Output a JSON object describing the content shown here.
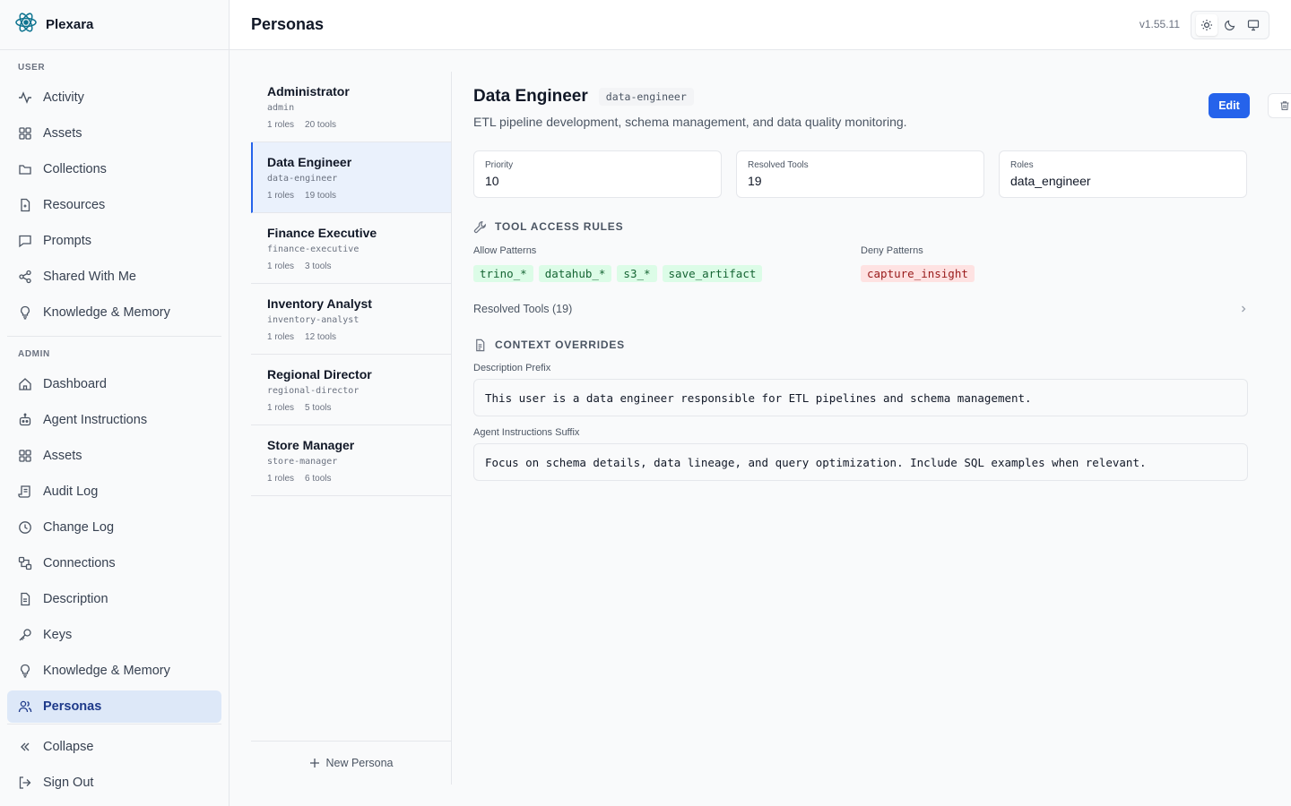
{
  "app": {
    "name": "Plexara",
    "version": "v1.55.11"
  },
  "header": {
    "title": "Personas"
  },
  "sidebar": {
    "user_label": "USER",
    "admin_label": "ADMIN",
    "user_items": [
      {
        "label": "Activity",
        "icon": "activity-icon"
      },
      {
        "label": "Assets",
        "icon": "grid-icon"
      },
      {
        "label": "Collections",
        "icon": "folder-icon"
      },
      {
        "label": "Resources",
        "icon": "file-icon"
      },
      {
        "label": "Prompts",
        "icon": "message-icon"
      },
      {
        "label": "Shared With Me",
        "icon": "share-icon"
      },
      {
        "label": "Knowledge & Memory",
        "icon": "lightbulb-icon"
      }
    ],
    "admin_items": [
      {
        "label": "Dashboard",
        "icon": "home-icon"
      },
      {
        "label": "Agent Instructions",
        "icon": "bot-icon"
      },
      {
        "label": "Assets",
        "icon": "grid-icon"
      },
      {
        "label": "Audit Log",
        "icon": "scroll-icon"
      },
      {
        "label": "Change Log",
        "icon": "clock-icon"
      },
      {
        "label": "Connections",
        "icon": "connection-icon"
      },
      {
        "label": "Description",
        "icon": "doc-icon"
      },
      {
        "label": "Keys",
        "icon": "key-icon"
      },
      {
        "label": "Knowledge & Memory",
        "icon": "lightbulb-icon"
      },
      {
        "label": "Personas",
        "icon": "users-icon"
      }
    ],
    "collapse": "Collapse",
    "signout": "Sign Out"
  },
  "personas": [
    {
      "name": "Administrator",
      "slug": "admin",
      "roles": "1 roles",
      "tools": "20 tools"
    },
    {
      "name": "Data Engineer",
      "slug": "data-engineer",
      "roles": "1 roles",
      "tools": "19 tools"
    },
    {
      "name": "Finance Executive",
      "slug": "finance-executive",
      "roles": "1 roles",
      "tools": "3 tools"
    },
    {
      "name": "Inventory Analyst",
      "slug": "inventory-analyst",
      "roles": "1 roles",
      "tools": "12 tools"
    },
    {
      "name": "Regional Director",
      "slug": "regional-director",
      "roles": "1 roles",
      "tools": "5 tools"
    },
    {
      "name": "Store Manager",
      "slug": "store-manager",
      "roles": "1 roles",
      "tools": "6 tools"
    }
  ],
  "new_persona": "New Persona",
  "detail": {
    "title": "Data Engineer",
    "slug": "data-engineer",
    "edit": "Edit",
    "description": "ETL pipeline development, schema management, and data quality monitoring.",
    "stats": [
      {
        "label": "Priority",
        "value": "10"
      },
      {
        "label": "Resolved Tools",
        "value": "19"
      },
      {
        "label": "Roles",
        "value": "data_engineer"
      }
    ],
    "tool_rules_heading": "TOOL ACCESS RULES",
    "allow_label": "Allow Patterns",
    "deny_label": "Deny Patterns",
    "allow": [
      "trino_*",
      "datahub_*",
      "s3_*",
      "save_artifact"
    ],
    "deny": [
      "capture_insight"
    ],
    "resolved_tools": "Resolved Tools (19)",
    "context_heading": "CONTEXT OVERRIDES",
    "desc_prefix_label": "Description Prefix",
    "desc_prefix": "This user is a data engineer responsible for ETL pipelines and schema management.",
    "agent_suffix_label": "Agent Instructions Suffix",
    "agent_suffix": "Focus on schema details, data lineage, and query optimization. Include SQL examples when relevant."
  },
  "colors": {
    "accent": "#2563eb",
    "allow_bg": "#dcfce7",
    "deny_bg": "#fee2e2",
    "active_nav": "#dde8f8"
  }
}
